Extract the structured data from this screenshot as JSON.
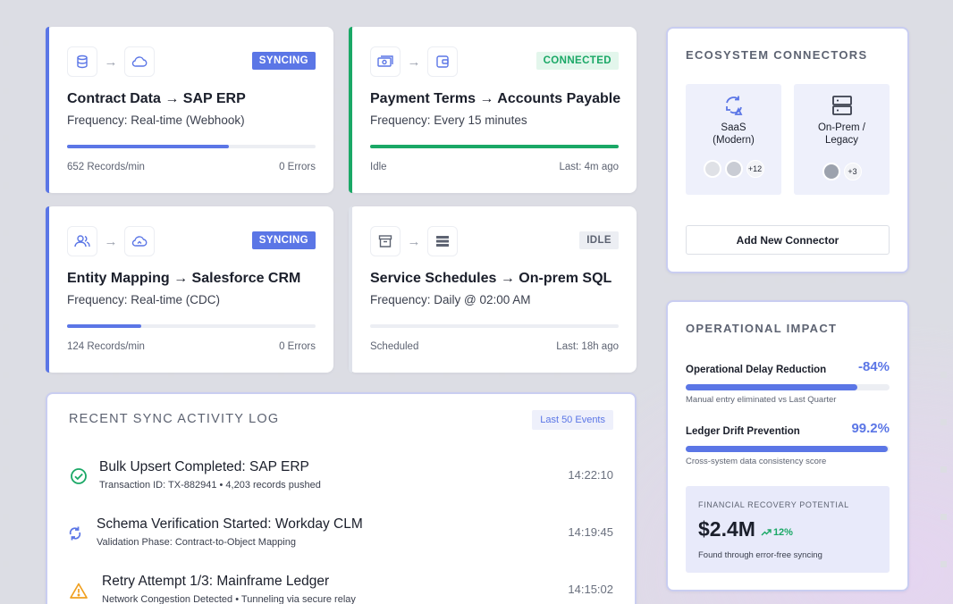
{
  "flows": [
    {
      "title": "Contract Data → SAP ERP",
      "frequency": "Frequency: Real-time (Webhook)",
      "status": "SYNCING",
      "progress": 0.65,
      "left_stat": "652 Records/min",
      "right_stat": "0 Errors",
      "from_icon": "database-icon",
      "to_icon": "cloud-icon"
    },
    {
      "title": "Payment Terms → Accounts Payable",
      "frequency": "Frequency: Every 15 minutes",
      "status": "CONNECTED",
      "progress": 1.0,
      "left_stat": "Idle",
      "right_stat": "Last: 4m ago",
      "from_icon": "money-icon",
      "to_icon": "wallet-icon"
    },
    {
      "title": "Entity Mapping → Salesforce CRM",
      "frequency": "Frequency: Real-time (CDC)",
      "status": "SYNCING",
      "progress": 0.3,
      "left_stat": "124 Records/min",
      "right_stat": "0 Errors",
      "from_icon": "users-icon",
      "to_icon": "cloud-sync-icon"
    },
    {
      "title": "Service Schedules → On-prem SQL",
      "frequency": "Frequency: Daily @ 02:00 AM",
      "status": "IDLE",
      "progress": 0,
      "left_stat": "Scheduled",
      "right_stat": "Last: 18h ago",
      "from_icon": "archive-icon",
      "to_icon": "server-list-icon"
    }
  ],
  "ecosystem": {
    "title": "ECOSYSTEM CONNECTORS",
    "saas_label": "SaaS\n(Modern)",
    "saas_more": "+12",
    "onprem_label": "On-Prem /\nLegacy",
    "onprem_more": "+3",
    "add_button": "Add New Connector"
  },
  "impact": {
    "title": "OPERATIONAL IMPACT",
    "metrics": [
      {
        "label": "Operational Delay Reduction",
        "value": "-84%",
        "progress": 0.84,
        "note": "Manual entry eliminated vs Last Quarter"
      },
      {
        "label": "Ledger Drift Prevention",
        "value": "99.2%",
        "progress": 0.992,
        "note": "Cross-system data consistency score"
      }
    ],
    "recovery_label": "FINANCIAL RECOVERY POTENTIAL",
    "recovery_value": "$2.4M",
    "recovery_trend": "12%",
    "recovery_note": "Found through error-free syncing"
  },
  "log": {
    "title": "RECENT SYNC ACTIVITY LOG",
    "filter": "Last 50 Events",
    "events": [
      {
        "title": "Bulk Upsert Completed: SAP ERP",
        "detail": "Transaction ID: TX-882941 • 4,203 records pushed",
        "time": "14:22:10",
        "icon": "check-circle-icon"
      },
      {
        "title": "Schema Verification Started: Workday CLM",
        "detail": "Validation Phase: Contract-to-Object Mapping",
        "time": "14:19:45",
        "icon": "refresh-icon"
      },
      {
        "title": "Retry Attempt 1/3: Mainframe Ledger",
        "detail": "Network Congestion Detected • Tunneling via secure relay",
        "time": "14:15:02",
        "icon": "warning-icon"
      }
    ]
  },
  "colors": {
    "accent": "#5b76e6",
    "success": "#1aa866",
    "warning": "#f0a020",
    "idle": "#dfe2ea"
  }
}
